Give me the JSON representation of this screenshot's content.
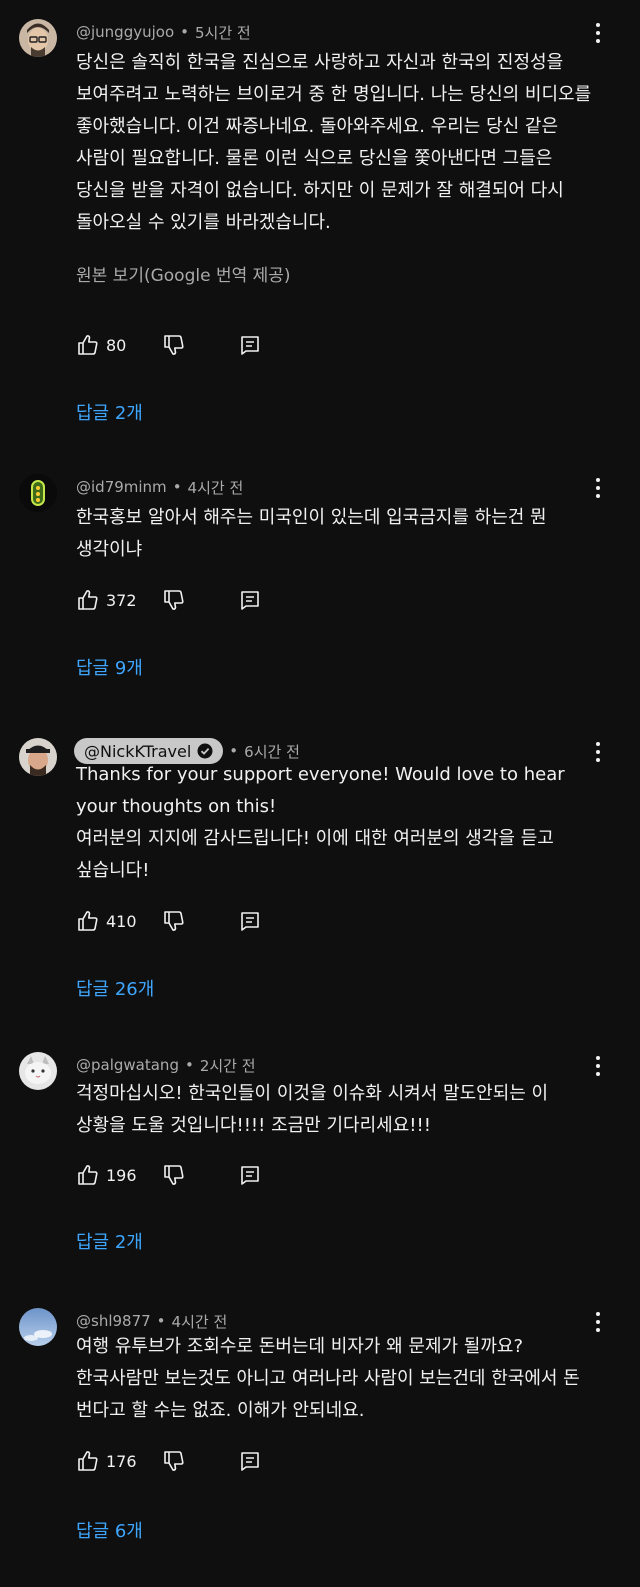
{
  "comments": [
    {
      "handle": "@junggyujoo",
      "time": "5시간 전",
      "lines": [
        "당신은 솔직히 한국을 진심으로 사랑하고 자신과 한국의 진정성을",
        "보여주려고 노력하는 브이로거 중 한 명입니다. 나는 당신의 비디오를",
        "좋아했습니다. 이건 짜증나네요. 돌아와주세요. 우리는 당신 같은",
        "사람이 필요합니다. 물론 이런 식으로 당신을 쫓아낸다면 그들은",
        "당신을 받을 자격이 없습니다. 하지만 이 문제가 잘 해결되어 다시",
        "돌아오실 수 있기를 바라겠습니다."
      ],
      "translate_label": "원본 보기(Google 번역 제공)",
      "likes": "80",
      "replies": "답글 2개"
    },
    {
      "handle": "@id79minm",
      "time": "4시간 전",
      "lines": [
        "한국홍보 알아서 해주는 미국인이 있는데 입국금지를 하는건 뭔",
        "생각이냐"
      ],
      "likes": "372",
      "replies": "답글 9개"
    },
    {
      "handle": "@NickKTravel",
      "time": "6시간 전",
      "lines": [
        "Thanks for your support everyone! Would love to hear",
        "your thoughts on this!",
        "여러분의 지지에 감사드립니다! 이에 대한 여러분의 생각을 듣고",
        "싶습니다!"
      ],
      "likes": "410",
      "replies": "답글 26개"
    },
    {
      "handle": "@palgwatang",
      "time": "2시간 전",
      "lines": [
        "걱정마십시오! 한국인들이 이것을 이슈화 시켜서 말도안되는 이",
        "상황을 도울 것입니다!!!! 조금만 기다리세요!!!"
      ],
      "likes": "196",
      "replies": "답글 2개"
    },
    {
      "handle": "@shl9877",
      "time": "4시간 전",
      "lines": [
        "여행 유투브가 조회수로 돈버는데 비자가 왜 문제가 될까요?",
        "한국사람만 보는것도 아니고 여러나라 사람이 보는건데 한국에서 돈",
        "번다고 할 수는 없죠. 이해가 안되네요."
      ],
      "likes": "176",
      "replies": "답글 6개"
    }
  ],
  "colors": {
    "background": "#0f0f0f",
    "link": "#3ea6ff",
    "muted": "#aaaaaa"
  }
}
